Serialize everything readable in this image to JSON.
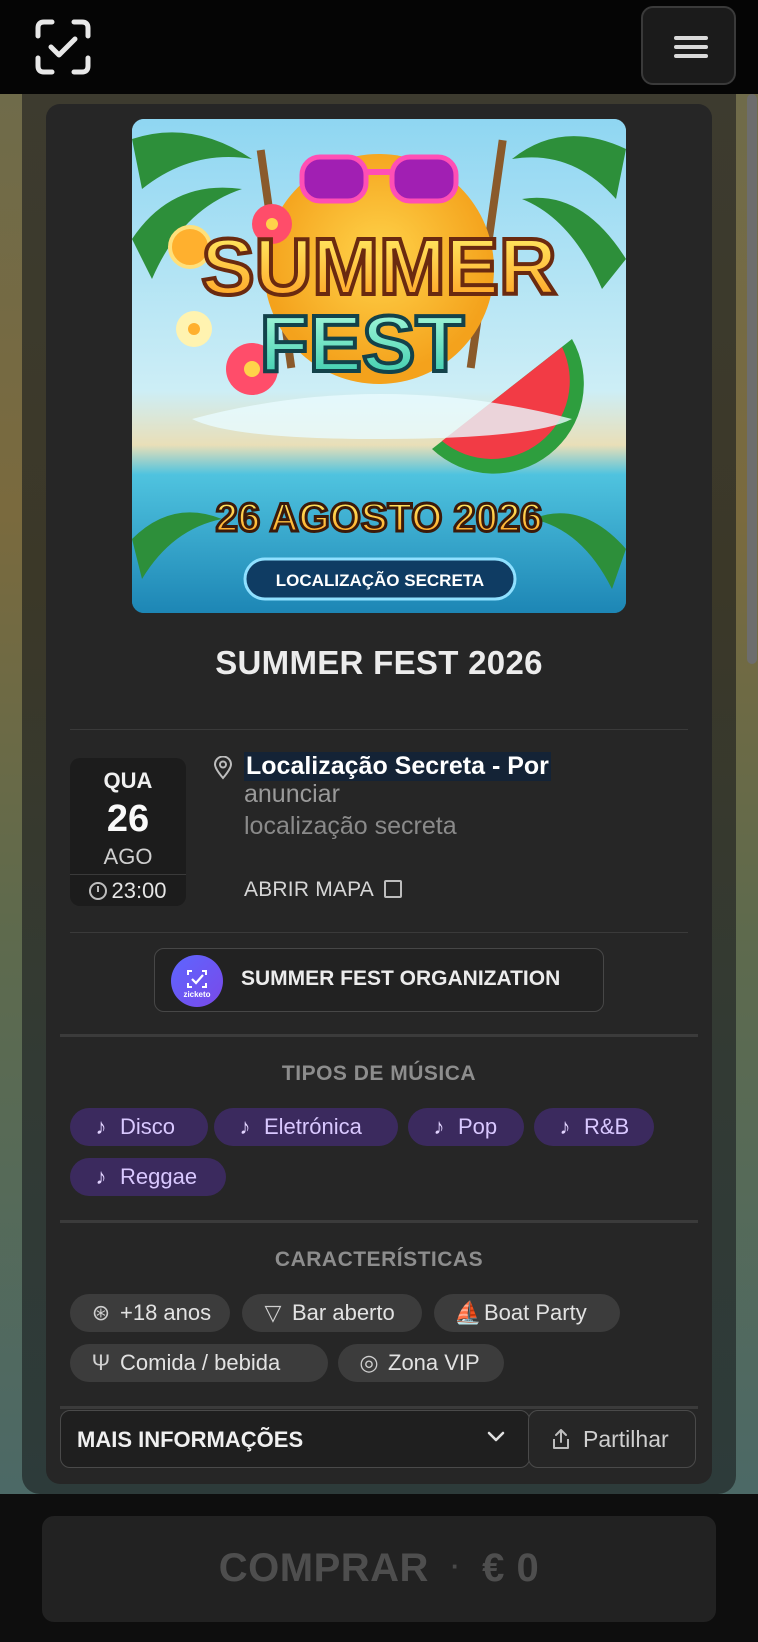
{
  "header": {
    "logo_icon": "zicketo-check-logo-icon",
    "menu_icon": "hamburger-menu-icon"
  },
  "event": {
    "poster": {
      "headline_line1": "SUMMER",
      "headline_line2": "FEST",
      "date_text": "26 AGOSTO 2026",
      "location_badge": "LOCALIZAÇÃO SECRETA"
    },
    "title": "SUMMER FEST 2026",
    "date": {
      "weekday": "QUA",
      "day": "26",
      "month": "AGO",
      "time": "23:00"
    },
    "location": {
      "name": "Localização Secreta - Por",
      "line2": "anunciar",
      "line3": "localização secreta",
      "map_link": "ABRIR MAPA"
    },
    "organizer": {
      "name": "SUMMER FEST ORGANIZATION",
      "avatar_text": "zicketo"
    }
  },
  "music": {
    "label": "TIPOS DE MÚSICA",
    "items": [
      "Disco",
      "Eletrónica",
      "Pop",
      "R&B",
      "Reggae"
    ]
  },
  "features": {
    "label": "CARACTERÍSTICAS",
    "items": [
      "+18 anos",
      "Bar aberto",
      "Boat Party",
      "Comida / bebida",
      "Zona VIP"
    ]
  },
  "actions": {
    "more_info": "MAIS INFORMAÇÕES",
    "share": "Partilhar"
  },
  "footer": {
    "buy_label": "COMPRAR",
    "separator": "·",
    "price": "€ 0"
  },
  "colors": {
    "accent_music_chip": "#3b2a5e",
    "card_bg": "#262626",
    "page_bg": "#0d0d0d"
  }
}
